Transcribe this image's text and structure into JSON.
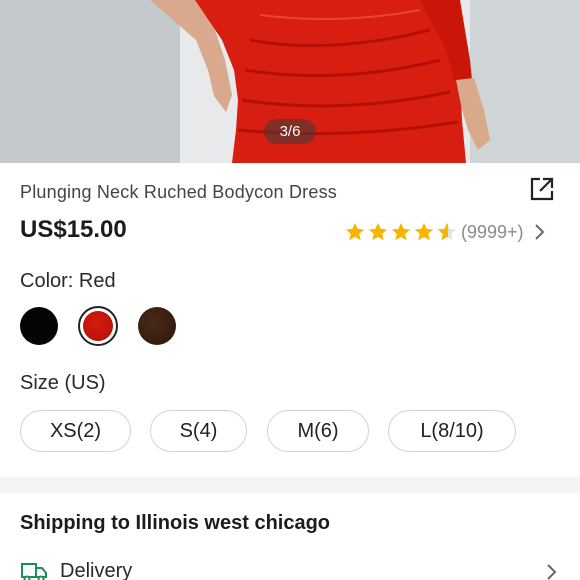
{
  "gallery": {
    "counter": "3/6"
  },
  "product": {
    "title": "Plunging Neck Ruched Bodycon Dress",
    "price": "US$15.00",
    "rating_value": 4.5,
    "review_count": "(9999+)",
    "star_color": "#f7b500"
  },
  "color": {
    "label": "Color: Red",
    "options": [
      {
        "name": "Black",
        "hex": "#050505",
        "selected": false
      },
      {
        "name": "Red",
        "hex": "#c8140c",
        "selected": true
      },
      {
        "name": "Brown",
        "hex": "#3a1f10",
        "selected": false
      }
    ]
  },
  "size": {
    "label": "Size (US)",
    "options": [
      "XS(2)",
      "S(4)",
      "M(6)",
      "L(8/10)"
    ]
  },
  "shipping": {
    "title": "Shipping to Illinois west chicago",
    "delivery_label": "Delivery",
    "delivery_icon": "truck-icon"
  },
  "icons": {
    "share": "share-icon",
    "chevron": "chevron-right-icon"
  }
}
